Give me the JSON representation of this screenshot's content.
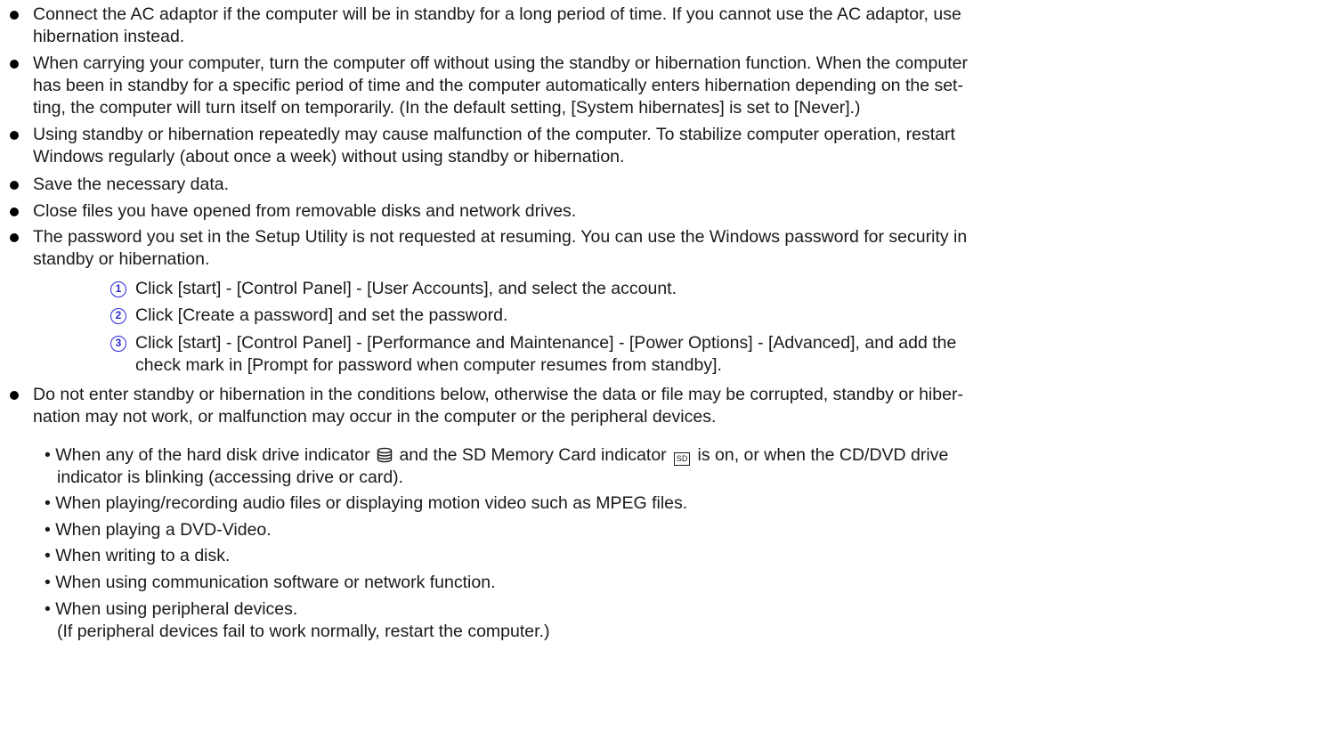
{
  "bullets": [
    {
      "lines": [
        "Connect the AC adaptor if the computer will be in standby for a long period of time. If you cannot use the AC adaptor, use",
        "hibernation instead."
      ]
    },
    {
      "lines": [
        "When carrying your computer, turn the computer off without using the standby or hibernation function. When the computer",
        "has been in standby for a specific period of time and the computer automatically enters hibernation depending on the set-",
        "ting, the computer will turn itself on temporarily. (In the default setting, [System hibernates] is set to [Never].)"
      ]
    },
    {
      "lines": [
        "Using standby or hibernation repeatedly may cause malfunction of the computer. To stabilize computer operation, restart",
        "Windows regularly (about once a week) without using standby or hibernation."
      ]
    },
    {
      "lines": [
        "Save the necessary data."
      ]
    },
    {
      "lines": [
        "Close files you have opened from removable disks and network drives."
      ]
    },
    {
      "lines": [
        "The password you set in the Setup Utility is not requested at resuming. You can use the Windows password for security in",
        "standby or hibernation."
      ]
    }
  ],
  "steps": [
    {
      "num": "1",
      "lines": [
        "Click [start] - [Control Panel] - [User Accounts], and select the account."
      ]
    },
    {
      "num": "2",
      "lines": [
        "Click [Create a password] and set the password."
      ]
    },
    {
      "num": "3",
      "lines": [
        "Click [start] - [Control Panel] - [Performance and Maintenance] - [Power Options] - [Advanced], and add the",
        "check mark in [Prompt for password when computer resumes from standby]."
      ]
    }
  ],
  "last_bullet": {
    "lines": [
      "Do not enter standby or hibernation in the conditions below, otherwise the data or file may be corrupted, standby or hiber-",
      "nation may not work, or malfunction may occur in the computer or the peripheral devices."
    ]
  },
  "conditions": {
    "first": {
      "part1": "When any of the hard disk drive indicator",
      "part2": "and the SD Memory Card indicator",
      "sd_icon_label": "SD",
      "part3": "is on, or when the CD/DVD drive",
      "line2": "indicator is blinking (accessing drive or card).",
      "hdd_icon": "hard-disk-drive-icon",
      "sd_icon": "sd-card-indicator-icon"
    },
    "items": [
      "When playing/recording audio files or displaying motion video such as MPEG files.",
      "When playing a DVD-Video.",
      "When writing to a disk.",
      "When using communication software or network function.",
      "When using peripheral devices."
    ],
    "note": "(If peripheral devices fail to work normally, restart the computer.)"
  },
  "colors": {
    "text": "#1a1a1a",
    "step_number": "#2b2bd6"
  }
}
